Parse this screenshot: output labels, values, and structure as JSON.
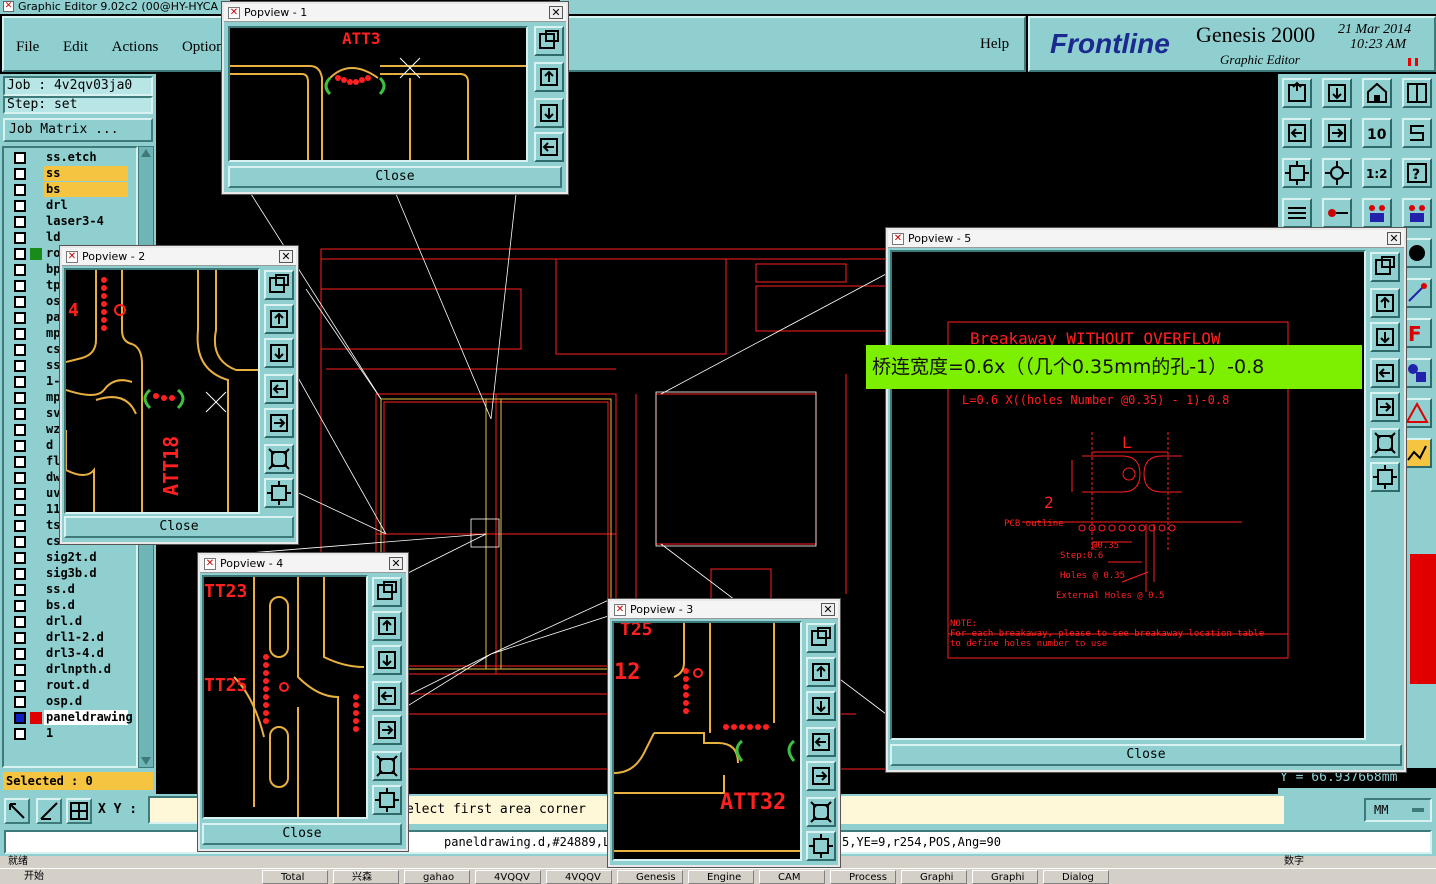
{
  "app": {
    "title": "Graphic Editor 9.02c2 (00@HY-HYCA"
  },
  "menu": {
    "file": "File",
    "edit": "Edit",
    "actions": "Actions",
    "options": "Options",
    "help": "Help"
  },
  "branding": {
    "logo": "Frontline",
    "product": "Genesis 2000",
    "subtitle": "Graphic Editor",
    "date": "21 Mar 2014",
    "time": "10:23 AM"
  },
  "job": {
    "job_label": "Job : 4v2qv03ja0",
    "step_label": "Step: set",
    "matrix_button": "Job Matrix ..."
  },
  "layers": [
    {
      "name": "ss.etch",
      "color": "#8fcfcf"
    },
    {
      "name": "ss",
      "color": "#f5c542"
    },
    {
      "name": "bs",
      "color": "#f5c542"
    },
    {
      "name": "drl",
      "color": "#8fcfcf"
    },
    {
      "name": "laser3-4",
      "color": "#8fcfcf"
    },
    {
      "name": "ld",
      "color": "#8fcfcf"
    },
    {
      "name": "rou",
      "color": "#8fcfcf"
    },
    {
      "name": "bp",
      "color": "#8fcfcf"
    },
    {
      "name": "tp",
      "color": "#8fcfcf"
    },
    {
      "name": "os",
      "color": "#8fcfcf"
    },
    {
      "name": "pa",
      "color": "#8fcfcf"
    },
    {
      "name": "mp",
      "color": "#8fcfcf"
    },
    {
      "name": "cs",
      "color": "#8fcfcf"
    },
    {
      "name": "ss",
      "color": "#8fcfcf"
    },
    {
      "name": "1-",
      "color": "#8fcfcf"
    },
    {
      "name": "mp",
      "color": "#8fcfcf"
    },
    {
      "name": "sv",
      "color": "#8fcfcf"
    },
    {
      "name": "wz",
      "color": "#8fcfcf"
    },
    {
      "name": "d",
      "color": "#8fcfcf"
    },
    {
      "name": "fl",
      "color": "#8fcfcf"
    },
    {
      "name": "dw",
      "color": "#8fcfcf"
    },
    {
      "name": "uv",
      "color": "#8fcfcf"
    },
    {
      "name": "11",
      "color": "#8fcfcf"
    },
    {
      "name": "ts",
      "color": "#8fcfcf"
    },
    {
      "name": "cs.d",
      "color": "#8fcfcf"
    },
    {
      "name": "sig2t.d",
      "color": "#8fcfcf"
    },
    {
      "name": "sig3b.d",
      "color": "#8fcfcf"
    },
    {
      "name": "ss.d",
      "color": "#8fcfcf"
    },
    {
      "name": "bs.d",
      "color": "#8fcfcf"
    },
    {
      "name": "drl.d",
      "color": "#8fcfcf"
    },
    {
      "name": "drl1-2.d",
      "color": "#8fcfcf"
    },
    {
      "name": "drl3-4.d",
      "color": "#8fcfcf"
    },
    {
      "name": "drlnpth.d",
      "color": "#8fcfcf"
    },
    {
      "name": "rout.d",
      "color": "#8fcfcf"
    },
    {
      "name": "osp.d",
      "color": "#8fcfcf"
    },
    {
      "name": "paneldrawing",
      "color": "#ffffff"
    },
    {
      "name": "1",
      "color": "#8fcfcf"
    }
  ],
  "status": {
    "selected": "Selected : 0",
    "xy_label": "X Y :",
    "prompt": "elect first area corner",
    "feature_info_left": "paneldrawing.d,#24889,L:",
    "feature_info_right": "5,YE=9,r254,POS,Ang=90",
    "y_coord": "Y = 66.937668mm",
    "units": "MM",
    "bottom_left": "就绪",
    "bottom_right": "数字"
  },
  "popviews": {
    "p1": {
      "title": "Popview - 1",
      "label": "ATT3",
      "close": "Close"
    },
    "p2": {
      "title": "Popview - 2",
      "label": "ATT18",
      "corner": "4",
      "close": "Close"
    },
    "p3": {
      "title": "Popview - 3",
      "label": "ATT32",
      "top": "T25",
      "side": "12",
      "close": "Close"
    },
    "p4": {
      "title": "Popview - 4",
      "label1": "TT23",
      "label2": "TT25",
      "close": "Close"
    },
    "p5": {
      "title": "Popview - 5",
      "heading": "Breakaway WITHOUT OVERFLOW",
      "formula": "L=0.6 X((holes Number @0.35) - 1)-0.8",
      "dim_L": "L",
      "dim_2": "2",
      "pcb_outline": "PCB outline",
      "d035": "@0.35",
      "step": "Step:0.6",
      "holes": "Holes @ 0.35",
      "ext_holes": "External Holes @ 0.5",
      "note_title": "NOTE:",
      "note_line1": "For each breakaway, please to see breakaway location table",
      "note_line2": "to define holes number to use",
      "close": "Close"
    }
  },
  "annotation": {
    "text": "桥连宽度=0.6x（（几个0.35mm的孔-1）-0.8",
    "color": "#7cf000"
  },
  "att_labels": [
    "ATT",
    "ATT",
    "ATT",
    "ATT",
    "ATT",
    "ATT",
    "ATT",
    "ATT",
    "ATT",
    "ATT",
    "ATT",
    "ATT",
    "ATT",
    "ATT",
    "ATT",
    "ATT",
    "ATT",
    "ATT",
    "ATT",
    "ATT",
    "ATT",
    "ATT",
    "ATT",
    "ATT",
    "ATT",
    "ATT",
    "ATT",
    "ATT",
    "ATT",
    "ATT",
    "ATT",
    "ATT",
    "ATT",
    "ATT",
    "ATT",
    "ATT",
    "ATT"
  ],
  "taskbar": {
    "start": "开始",
    "items": [
      "Total",
      "兴森",
      "gahao",
      "4VQQV",
      "4VQQV",
      "Genesis",
      "Engine",
      "CAM",
      "Process",
      "Graphi",
      "Graphi",
      "Dialog"
    ]
  }
}
